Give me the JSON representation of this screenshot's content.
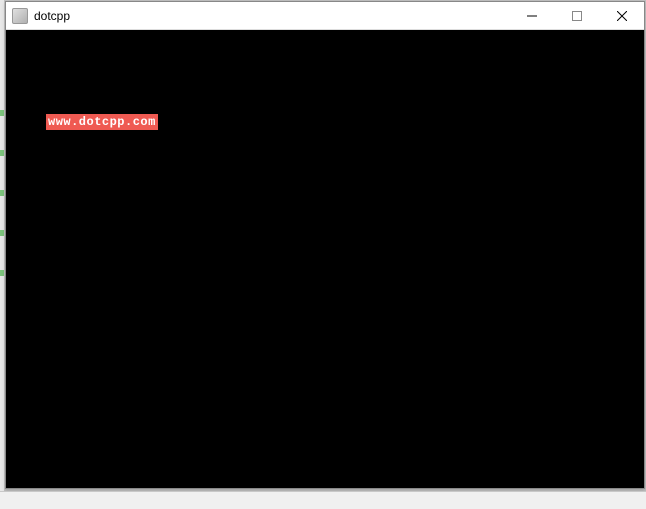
{
  "window": {
    "title": "dotcpp"
  },
  "controls": {
    "minimize_label": "Minimize",
    "maximize_label": "Maximize",
    "close_label": "Close"
  },
  "output": {
    "text": "www.dotcpp.com"
  }
}
